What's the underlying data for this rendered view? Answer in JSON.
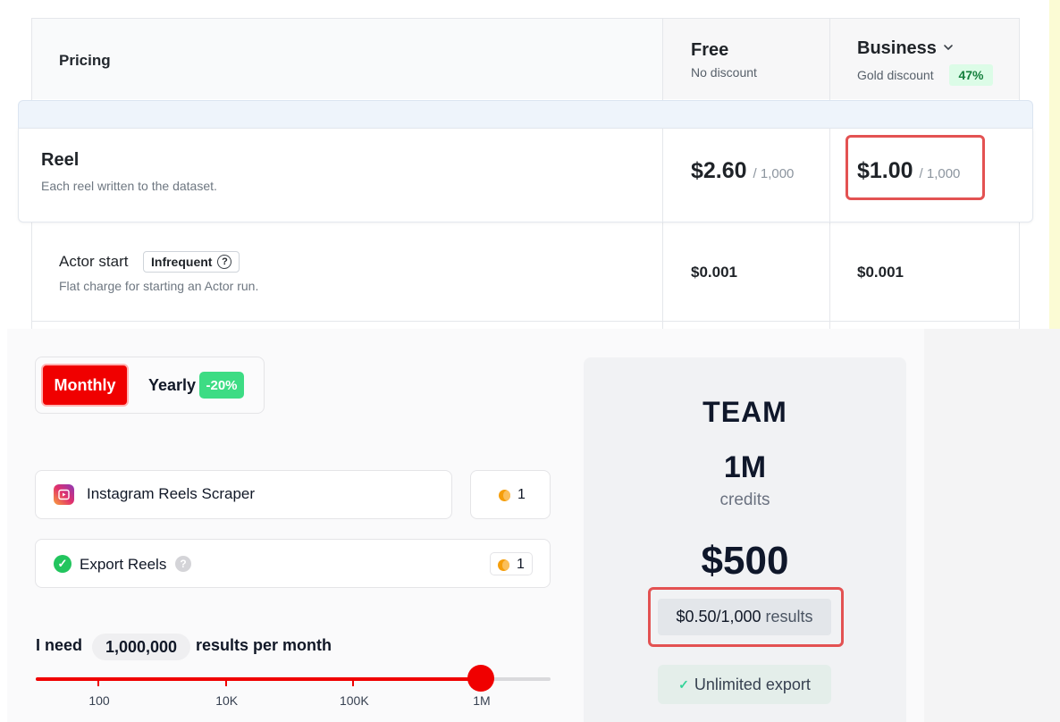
{
  "pricing_table": {
    "header_label": "Pricing",
    "plans": [
      {
        "name": "Free",
        "discount_text": "No discount"
      },
      {
        "name": "Business",
        "discount_text": "Gold discount",
        "discount_badge": "47%",
        "has_dropdown": true
      }
    ],
    "rows": [
      {
        "title": "Reel",
        "description": "Each reel written to the dataset.",
        "free_price": "$2.60",
        "free_unit": "/ 1,000",
        "business_price": "$1.00",
        "business_unit": "/ 1,000"
      },
      {
        "title": "Actor start",
        "tag": "Infrequent",
        "description": "Flat charge for starting an Actor run.",
        "free_price": "$0.001",
        "business_price": "$0.001"
      }
    ]
  },
  "calculator": {
    "billing": {
      "monthly_label": "Monthly",
      "yearly_label": "Yearly",
      "yearly_badge": "-20%",
      "selected": "Monthly"
    },
    "actor": {
      "name": "Instagram Reels Scraper",
      "credits": "1"
    },
    "export": {
      "label": "Export Reels",
      "help": "?",
      "credits": "1"
    },
    "need": {
      "prefix": "I need",
      "amount": "1,000,000",
      "suffix": "results per month"
    },
    "slider": {
      "ticks": [
        "100",
        "10K",
        "100K",
        "1M"
      ],
      "selected_index": 3
    }
  },
  "plan_card": {
    "name": "TEAM",
    "credits": "1M",
    "credits_label": "credits",
    "price": "$500",
    "per_result": "$0.50/1,000",
    "per_result_suffix": "results",
    "feature": "Unlimited export"
  },
  "colors": {
    "brand_red": "#f00000",
    "highlight_box": "#e35252",
    "badge_green": "#3ddc84",
    "discount_green_bg": "#dcfce7",
    "discount_green_text": "#15803d"
  },
  "icons": {
    "business_dropdown": "chevron-down-icon",
    "infrequent_help": "question-circle-icon",
    "actor": "instagram-icon",
    "credit": "coin-icon",
    "export_status": "check-circle-icon",
    "export_help": "question-circle-icon",
    "feature_check": "check-icon"
  }
}
